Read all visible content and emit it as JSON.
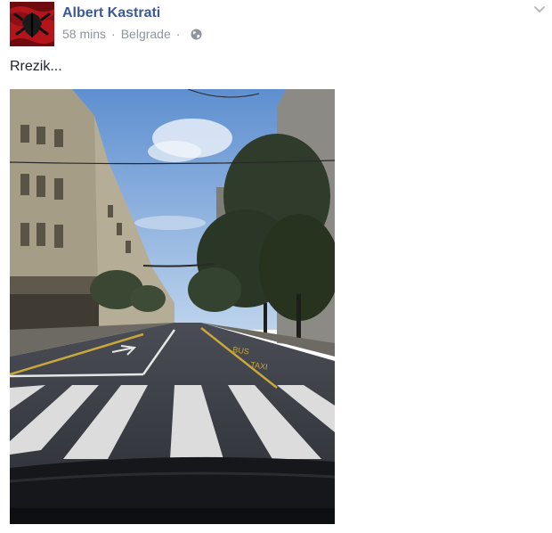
{
  "post": {
    "author_name": "Albert Kastrati",
    "timestamp": "58 mins",
    "separator": "·",
    "location": "Belgrade",
    "audience_icon": "globe-icon",
    "options_icon": "chevron-down-icon",
    "text": "Rrezik...",
    "photo": {
      "subject": "street-photo-crosswalk"
    }
  },
  "colors": {
    "author_link": "#3b5998",
    "meta_gray": "#90949c",
    "text": "#1d2129",
    "flag_red": "#b3151b"
  }
}
